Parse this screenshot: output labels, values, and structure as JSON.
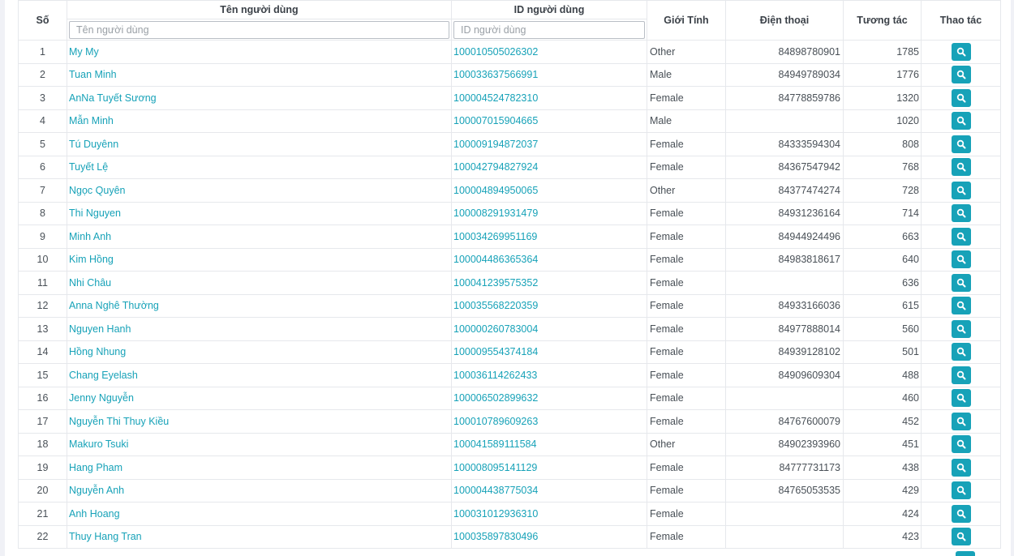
{
  "table": {
    "headers": {
      "no": "Số",
      "name": "Tên người dùng",
      "id": "ID người dùng",
      "gender": "Giới Tính",
      "phone": "Điện thoại",
      "interactions": "Tương tác",
      "actions": "Thao tác"
    },
    "filters": {
      "name_placeholder": "Tên người dùng",
      "name_value": "",
      "id_placeholder": "ID người dùng",
      "id_value": ""
    },
    "action_icon": "search-icon",
    "accent_color": "#17a2b8",
    "rows": [
      {
        "no": "1",
        "name": "My My",
        "id": "100010505026302",
        "gender": "Other",
        "phone": "84898780901",
        "interactions": "1785"
      },
      {
        "no": "2",
        "name": "Tuan Minh",
        "id": "100033637566991",
        "gender": "Male",
        "phone": "84949789034",
        "interactions": "1776"
      },
      {
        "no": "3",
        "name": "AnNa Tuyết Sương",
        "id": "100004524782310",
        "gender": "Female",
        "phone": "84778859786",
        "interactions": "1320"
      },
      {
        "no": "4",
        "name": "Mẫn Minh",
        "id": "100007015904665",
        "gender": "Male",
        "phone": "",
        "interactions": "1020"
      },
      {
        "no": "5",
        "name": "Tú Duyênn",
        "id": "100009194872037",
        "gender": "Female",
        "phone": "84333594304",
        "interactions": "808"
      },
      {
        "no": "6",
        "name": "Tuyết Lệ",
        "id": "100042794827924",
        "gender": "Female",
        "phone": "84367547942",
        "interactions": "768"
      },
      {
        "no": "7",
        "name": "Ngọc Quyên",
        "id": "100004894950065",
        "gender": "Other",
        "phone": "84377474274",
        "interactions": "728"
      },
      {
        "no": "8",
        "name": "Thi Nguyen",
        "id": "100008291931479",
        "gender": "Female",
        "phone": "84931236164",
        "interactions": "714"
      },
      {
        "no": "9",
        "name": "Minh Anh",
        "id": "100034269951169",
        "gender": "Female",
        "phone": "84944924496",
        "interactions": "663"
      },
      {
        "no": "10",
        "name": "Kim Hồng",
        "id": "100004486365364",
        "gender": "Female",
        "phone": "84983818617",
        "interactions": "640"
      },
      {
        "no": "11",
        "name": "Nhi Châu",
        "id": "100041239575352",
        "gender": "Female",
        "phone": "",
        "interactions": "636"
      },
      {
        "no": "12",
        "name": "Anna Nghê Thường",
        "id": "100035568220359",
        "gender": "Female",
        "phone": "84933166036",
        "interactions": "615"
      },
      {
        "no": "13",
        "name": "Nguyen Hanh",
        "id": "100000260783004",
        "gender": "Female",
        "phone": "84977888014",
        "interactions": "560"
      },
      {
        "no": "14",
        "name": "Hồng Nhung",
        "id": "100009554374184",
        "gender": "Female",
        "phone": "84939128102",
        "interactions": "501"
      },
      {
        "no": "15",
        "name": "Chang Eyelash",
        "id": "100036114262433",
        "gender": "Female",
        "phone": "84909609304",
        "interactions": "488"
      },
      {
        "no": "16",
        "name": "Jenny Nguyễn",
        "id": "100006502899632",
        "gender": "Female",
        "phone": "",
        "interactions": "460"
      },
      {
        "no": "17",
        "name": "Nguyễn Thi Thuy Kiều",
        "id": "100010789609263",
        "gender": "Female",
        "phone": "84767600079",
        "interactions": "452"
      },
      {
        "no": "18",
        "name": "Makuro Tsuki",
        "id": "100041589111584",
        "gender": "Other",
        "phone": "84902393960",
        "interactions": "451"
      },
      {
        "no": "19",
        "name": "Hang Pham",
        "id": "100008095141129",
        "gender": "Female",
        "phone": "84777731173",
        "interactions": "438"
      },
      {
        "no": "20",
        "name": "Nguyễn Anh",
        "id": "100004438775034",
        "gender": "Female",
        "phone": "84765053535",
        "interactions": "429"
      },
      {
        "no": "21",
        "name": "Anh Hoang",
        "id": "100031012936310",
        "gender": "Female",
        "phone": "",
        "interactions": "424"
      },
      {
        "no": "22",
        "name": "Thuy Hang Tran",
        "id": "100035897830496",
        "gender": "Female",
        "phone": "",
        "interactions": "423"
      }
    ]
  }
}
